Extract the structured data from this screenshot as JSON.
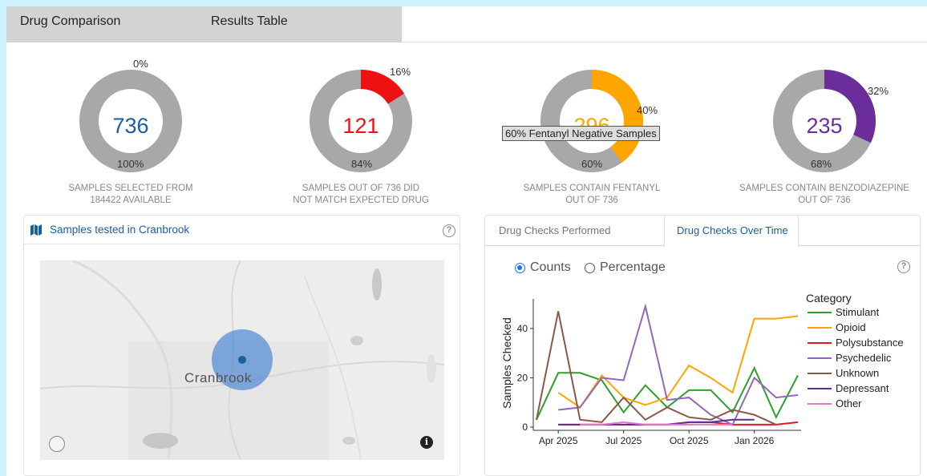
{
  "tabs": [
    "Drug Comparison",
    "Results Table"
  ],
  "donuts": [
    {
      "value": "736",
      "color": "#1a5fa0",
      "fraction": 0.0,
      "top_pct": "0%",
      "bottom_pct": "100%",
      "caption1": "SAMPLES SELECTED FROM",
      "caption2": "184422 AVAILABLE"
    },
    {
      "value": "121",
      "color": "#ee1111",
      "fraction": 0.16,
      "top_pct": "16%",
      "bottom_pct": "84%",
      "caption1": "SAMPLES OUT OF 736 DID",
      "caption2": "NOT MATCH EXPECTED DRUG"
    },
    {
      "value": "296",
      "color": "#ffa500",
      "fraction": 0.4,
      "top_pct": "40%",
      "bottom_pct": "60%",
      "caption1": "SAMPLES CONTAIN FENTANYL",
      "caption2": "OUT OF 736"
    },
    {
      "value": "235",
      "color": "#6a2d9a",
      "fraction": 0.32,
      "top_pct": "32%",
      "bottom_pct": "68%",
      "caption1": "SAMPLES CONTAIN BENZODIAZEPINE",
      "caption2": "OUT OF 736"
    }
  ],
  "tooltip": "60% Fentanyl Negative Samples",
  "map": {
    "title": "Samples tested in Cranbrook",
    "city_label": "Cranbrook",
    "help": "?"
  },
  "chart_panel": {
    "tabs": [
      "Drug Checks Performed",
      "Drug Checks Over Time"
    ],
    "radio_counts": "Counts",
    "radio_percentage": "Percentage",
    "help": "?"
  },
  "chart_data": {
    "type": "line",
    "ylabel": "Samples Checked",
    "ylim": [
      0,
      52
    ],
    "yticks": [
      0,
      20,
      40
    ],
    "xtick_labels": [
      "Apr 2025",
      "Jul 2025",
      "Oct 2025",
      "Jan 2026"
    ],
    "xtick_index": [
      1,
      4,
      7,
      10
    ],
    "x": [
      "Mar 2025",
      "Apr 2025",
      "May 2025",
      "Jun 2025",
      "Jul 2025",
      "Aug 2025",
      "Sep 2025",
      "Oct 2025",
      "Nov 2025",
      "Dec 2025",
      "Jan 2026",
      "Feb 2026",
      "Mar 2026"
    ],
    "legend_title": "Category",
    "series": [
      {
        "name": "Stimulant",
        "color": "#2ca02c",
        "values": [
          3,
          22,
          22,
          19,
          6,
          17,
          8,
          15,
          15,
          6,
          24,
          4,
          21
        ]
      },
      {
        "name": "Opioid",
        "color": "#ffa500",
        "values": [
          null,
          14,
          8,
          21,
          12,
          9,
          12,
          25,
          20,
          14,
          44,
          44,
          45
        ]
      },
      {
        "name": "Polysubstance",
        "color": "#dd1c1c",
        "values": [
          null,
          1,
          1,
          1,
          1,
          1,
          1,
          2,
          2,
          1,
          1,
          1,
          2
        ]
      },
      {
        "name": "Psychedelic",
        "color": "#9467bd",
        "values": [
          null,
          7,
          8,
          20,
          19,
          49,
          11,
          12,
          5,
          1,
          20,
          12,
          13
        ]
      },
      {
        "name": "Unknown",
        "color": "#8c564b",
        "values": [
          3,
          47,
          3,
          2,
          12,
          3,
          8,
          4,
          3,
          7,
          5,
          1,
          null
        ]
      },
      {
        "name": "Depressant",
        "color": "#5b2c9a",
        "values": [
          null,
          1,
          1,
          1,
          1,
          1,
          1,
          2,
          2,
          3,
          3,
          null,
          null
        ]
      },
      {
        "name": "Other",
        "color": "#e377c2",
        "values": [
          null,
          null,
          1,
          1,
          2,
          1,
          1,
          1,
          1,
          1,
          null,
          null,
          null
        ]
      }
    ]
  }
}
